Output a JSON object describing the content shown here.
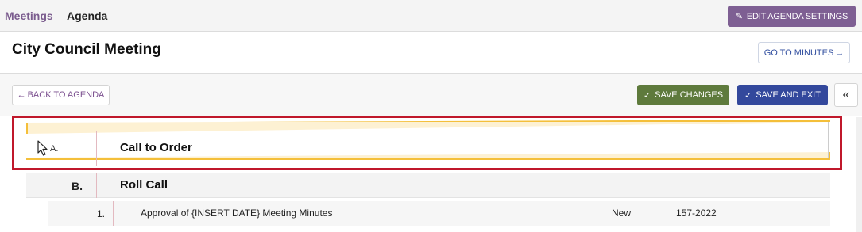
{
  "topbar": {
    "meetings_label": "Meetings",
    "agenda_label": "Agenda",
    "edit_settings_label": "EDIT AGENDA SETTINGS",
    "edit_icon": "pencil-icon"
  },
  "header": {
    "title": "City Council Meeting",
    "goto_minutes_label": "GO TO MINUTES",
    "goto_arrow": "→"
  },
  "toolbar": {
    "back_arrow": "←",
    "back_label": "BACK TO AGENDA",
    "save_changes_label": "SAVE CHANGES",
    "save_exit_label": "SAVE AND EXIT",
    "check_icon": "✓",
    "collapse_label": "«"
  },
  "agenda": {
    "dragging_item": {
      "letter": "A.",
      "title": "Call to Order"
    },
    "items": [
      {
        "letter": "B.",
        "title": "Roll Call"
      }
    ],
    "subitems": [
      {
        "number": "1.",
        "title": "Approval of {INSERT DATE} Meeting Minutes",
        "status": "New",
        "code": "157-2022"
      }
    ]
  },
  "colors": {
    "purple": "#7e5f93",
    "green": "#5e7a3c",
    "blue": "#33489c",
    "highlight_red": "#c0182b",
    "drag_yellow": "#f4bf3a"
  }
}
